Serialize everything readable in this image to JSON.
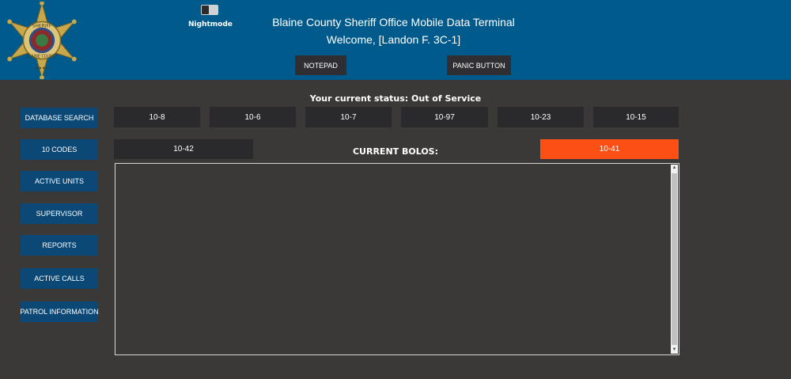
{
  "header": {
    "title": "Blaine County Sheriff Office Mobile Data Terminal",
    "welcome": "Welcome,  [Landon F. 3C-1]",
    "nightmode_label": "Nightmode",
    "notepad_label": "NOTEPAD",
    "panic_label": "PANIC BUTTON",
    "badge": {
      "top_text": "SHERIFF",
      "bottom_text": "BLAINE COUNTY",
      "stars": "★★★★"
    }
  },
  "sidebar": {
    "items": [
      {
        "label": "DATABASE SEARCH"
      },
      {
        "label": "10 CODES"
      },
      {
        "label": "ACTIVE UNITS"
      },
      {
        "label": "SUPERVISOR"
      },
      {
        "label": "REPORTS"
      },
      {
        "label": "ACTIVE CALLS"
      },
      {
        "label": "PATROL INFORMATION"
      }
    ]
  },
  "status": {
    "text": "Your current status: Out of Service"
  },
  "codes": {
    "row1": [
      "10-8",
      "10-6",
      "10-7",
      "10-97",
      "10-23",
      "10-15"
    ],
    "row2_left": "10-42",
    "row2_right": "10-41"
  },
  "bolos": {
    "label": "CURRENT BOLOS:",
    "content": ""
  },
  "colors": {
    "header_bg": "#005a8c",
    "page_bg": "#3b3937",
    "sidebar_button": "#0b4876",
    "code_button": "#2a2a2d",
    "accent_orange": "#fb4f14"
  }
}
